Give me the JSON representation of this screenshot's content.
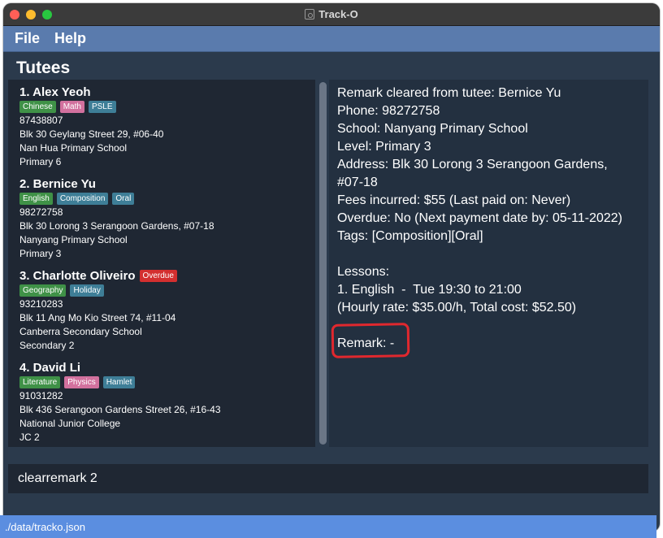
{
  "window": {
    "title": "Track-O"
  },
  "menu": {
    "file": "File",
    "help": "Help"
  },
  "section_title": "Tutees",
  "tutees": [
    {
      "name": "1.  Alex Yeoh",
      "badge": "",
      "tags": [
        {
          "label": "Chinese",
          "color": "green"
        },
        {
          "label": "Math",
          "color": "pink"
        },
        {
          "label": "PSLE",
          "color": "teal"
        }
      ],
      "phone": "87438807",
      "address": "Blk 30 Geylang Street 29, #06-40",
      "school": "Nan Hua Primary School",
      "level": "Primary 6"
    },
    {
      "name": "2.  Bernice Yu",
      "badge": "",
      "tags": [
        {
          "label": "English",
          "color": "green"
        },
        {
          "label": "Composition",
          "color": "teal"
        },
        {
          "label": "Oral",
          "color": "teal"
        }
      ],
      "phone": "98272758",
      "address": "Blk 30 Lorong 3 Serangoon Gardens, #07-18",
      "school": "Nanyang Primary School",
      "level": "Primary 3"
    },
    {
      "name": "3.  Charlotte Oliveiro",
      "badge": "Overdue",
      "tags": [
        {
          "label": "Geography",
          "color": "green"
        },
        {
          "label": "Holiday",
          "color": "teal"
        }
      ],
      "phone": "93210283",
      "address": "Blk 11 Ang Mo Kio Street 74, #11-04",
      "school": "Canberra Secondary School",
      "level": "Secondary 2"
    },
    {
      "name": "4.  David Li",
      "badge": "",
      "tags": [
        {
          "label": "Literature",
          "color": "green"
        },
        {
          "label": "Physics",
          "color": "pink"
        },
        {
          "label": "Hamlet",
          "color": "teal"
        }
      ],
      "phone": "91031282",
      "address": "Blk 436 Serangoon Gardens Street 26, #16-43",
      "school": "National Junior College",
      "level": "JC 2"
    }
  ],
  "detail": {
    "lines": [
      "Remark cleared from tutee: Bernice Yu",
      "Phone: 98272758",
      "School: Nanyang Primary School",
      "Level: Primary 3",
      "Address: Blk 30 Lorong 3 Serangoon Gardens,",
      "#07-18",
      "Fees incurred: $55 (Last paid on: Never)",
      "Overdue: No (Next payment date by: 05-11-2022)",
      "Tags: [Composition][Oral]",
      "",
      "Lessons:",
      "1. English  -  Tue 19:30 to 21:00",
      "(Hourly rate: $35.00/h, Total cost: $52.50)",
      "",
      "Remark: -"
    ]
  },
  "command": {
    "value": "clearremark 2"
  },
  "status": {
    "path": "./data/tracko.json"
  }
}
